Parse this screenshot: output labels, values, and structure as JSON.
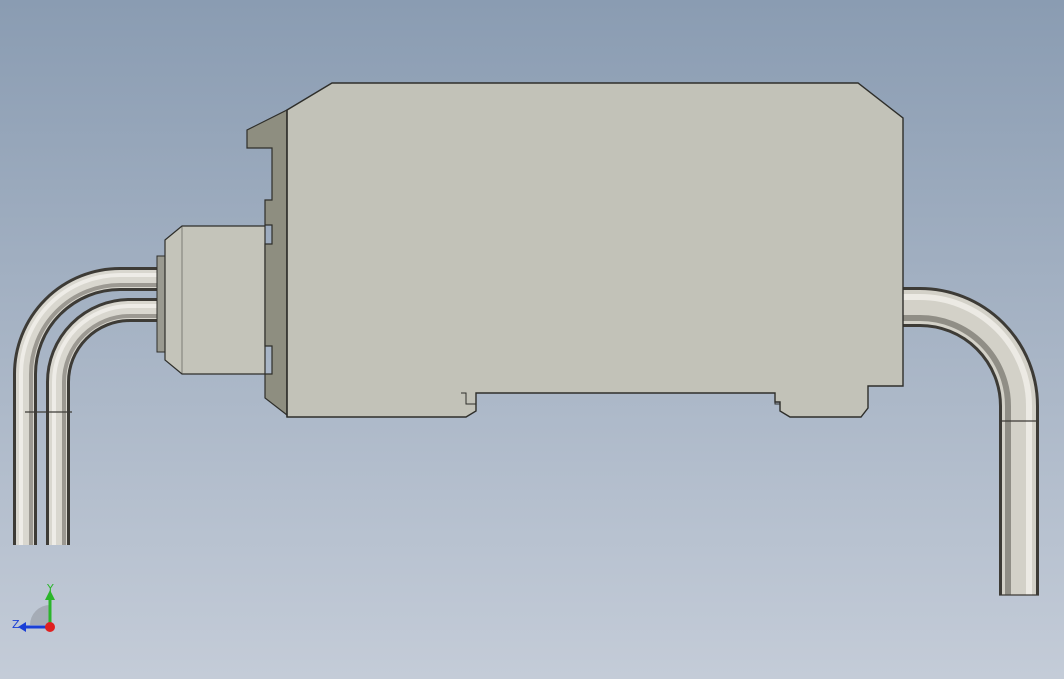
{
  "viewport": {
    "background_top": "#8a9cb2",
    "background_bottom": "#c4ccd8"
  },
  "model": {
    "body_color": "#c2c2b8",
    "body_side_color": "#8e8e80",
    "tube_color": "#b9b6ad"
  },
  "triad": {
    "y_label": "Y",
    "z_label": "Z",
    "y_color": "#2bb52b",
    "z_color": "#1a3fd6",
    "origin_color": "#e02020"
  }
}
